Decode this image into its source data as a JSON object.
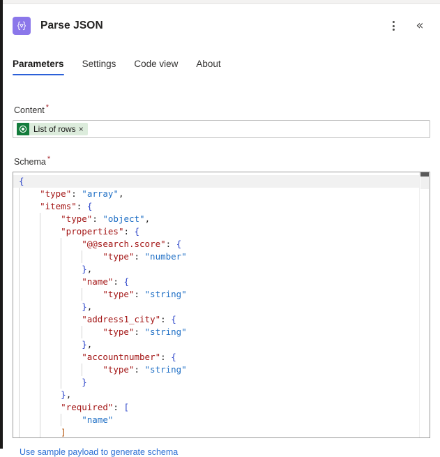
{
  "header": {
    "node_icon_name": "parse-json-node-icon",
    "title": "Parse JSON",
    "more_label": "⋮",
    "collapse_label": "«",
    "accent_icon_color": "#8b77ea"
  },
  "tabs": [
    {
      "label": "Parameters",
      "active": true
    },
    {
      "label": "Settings",
      "active": false
    },
    {
      "label": "Code view",
      "active": false
    },
    {
      "label": "About",
      "active": false
    }
  ],
  "tab_accent_color": "#2b60d8",
  "fields": {
    "content": {
      "label": "Content",
      "required_marker": "*",
      "token": {
        "label": "List of rows",
        "remove_label": "×",
        "icon_name": "dataverse-token-icon",
        "icon_color": "#147c3c",
        "chip_bg": "#dcecdc"
      }
    },
    "schema": {
      "label": "Schema",
      "required_marker": "*"
    }
  },
  "editor": {
    "colors": {
      "key": "#a31515",
      "string": "#1f6fc5",
      "punct": "#2b44c9",
      "bracket_match": "#b45309",
      "current_line": "#f1f1f1"
    },
    "lines": [
      {
        "indent": 0,
        "current": true,
        "tokens": [
          {
            "t": "punct",
            "v": "{"
          }
        ]
      },
      {
        "indent": 1,
        "current": false,
        "tokens": [
          {
            "t": "key",
            "v": "\"type\""
          },
          {
            "t": "plain",
            "v": ": "
          },
          {
            "t": "str",
            "v": "\"array\""
          },
          {
            "t": "plain",
            "v": ","
          }
        ]
      },
      {
        "indent": 1,
        "current": false,
        "tokens": [
          {
            "t": "key",
            "v": "\"items\""
          },
          {
            "t": "plain",
            "v": ": "
          },
          {
            "t": "punct",
            "v": "{"
          }
        ]
      },
      {
        "indent": 2,
        "current": false,
        "tokens": [
          {
            "t": "key",
            "v": "\"type\""
          },
          {
            "t": "plain",
            "v": ": "
          },
          {
            "t": "str",
            "v": "\"object\""
          },
          {
            "t": "plain",
            "v": ","
          }
        ]
      },
      {
        "indent": 2,
        "current": false,
        "tokens": [
          {
            "t": "key",
            "v": "\"properties\""
          },
          {
            "t": "plain",
            "v": ": "
          },
          {
            "t": "punct",
            "v": "{"
          }
        ]
      },
      {
        "indent": 3,
        "current": false,
        "tokens": [
          {
            "t": "key",
            "v": "\"@@search.score\""
          },
          {
            "t": "plain",
            "v": ": "
          },
          {
            "t": "punct",
            "v": "{"
          }
        ]
      },
      {
        "indent": 4,
        "current": false,
        "tokens": [
          {
            "t": "key",
            "v": "\"type\""
          },
          {
            "t": "plain",
            "v": ": "
          },
          {
            "t": "str",
            "v": "\"number\""
          }
        ]
      },
      {
        "indent": 3,
        "current": false,
        "tokens": [
          {
            "t": "punct",
            "v": "}"
          },
          {
            "t": "plain",
            "v": ","
          }
        ]
      },
      {
        "indent": 3,
        "current": false,
        "tokens": [
          {
            "t": "key",
            "v": "\"name\""
          },
          {
            "t": "plain",
            "v": ": "
          },
          {
            "t": "punct",
            "v": "{"
          }
        ]
      },
      {
        "indent": 4,
        "current": false,
        "tokens": [
          {
            "t": "key",
            "v": "\"type\""
          },
          {
            "t": "plain",
            "v": ": "
          },
          {
            "t": "str",
            "v": "\"string\""
          }
        ]
      },
      {
        "indent": 3,
        "current": false,
        "tokens": [
          {
            "t": "punct",
            "v": "}"
          },
          {
            "t": "plain",
            "v": ","
          }
        ]
      },
      {
        "indent": 3,
        "current": false,
        "tokens": [
          {
            "t": "key",
            "v": "\"address1_city\""
          },
          {
            "t": "plain",
            "v": ": "
          },
          {
            "t": "punct",
            "v": "{"
          }
        ]
      },
      {
        "indent": 4,
        "current": false,
        "tokens": [
          {
            "t": "key",
            "v": "\"type\""
          },
          {
            "t": "plain",
            "v": ": "
          },
          {
            "t": "str",
            "v": "\"string\""
          }
        ]
      },
      {
        "indent": 3,
        "current": false,
        "tokens": [
          {
            "t": "punct",
            "v": "}"
          },
          {
            "t": "plain",
            "v": ","
          }
        ]
      },
      {
        "indent": 3,
        "current": false,
        "tokens": [
          {
            "t": "key",
            "v": "\"accountnumber\""
          },
          {
            "t": "plain",
            "v": ": "
          },
          {
            "t": "punct",
            "v": "{"
          }
        ]
      },
      {
        "indent": 4,
        "current": false,
        "tokens": [
          {
            "t": "key",
            "v": "\"type\""
          },
          {
            "t": "plain",
            "v": ": "
          },
          {
            "t": "str",
            "v": "\"string\""
          }
        ]
      },
      {
        "indent": 3,
        "current": false,
        "tokens": [
          {
            "t": "punct",
            "v": "}"
          }
        ]
      },
      {
        "indent": 2,
        "current": false,
        "tokens": [
          {
            "t": "punct",
            "v": "}"
          },
          {
            "t": "plain",
            "v": ","
          }
        ]
      },
      {
        "indent": 2,
        "current": false,
        "tokens": [
          {
            "t": "key",
            "v": "\"required\""
          },
          {
            "t": "plain",
            "v": ": "
          },
          {
            "t": "punct",
            "v": "["
          }
        ]
      },
      {
        "indent": 3,
        "current": false,
        "tokens": [
          {
            "t": "str",
            "v": "\"name\""
          }
        ]
      },
      {
        "indent": 2,
        "current": false,
        "tokens": [
          {
            "t": "match",
            "v": "]"
          }
        ]
      }
    ],
    "scrollbar": {
      "name": "editor-vertical-scrollbar"
    }
  },
  "footer": {
    "sample_payload_link": "Use sample payload to generate schema"
  }
}
